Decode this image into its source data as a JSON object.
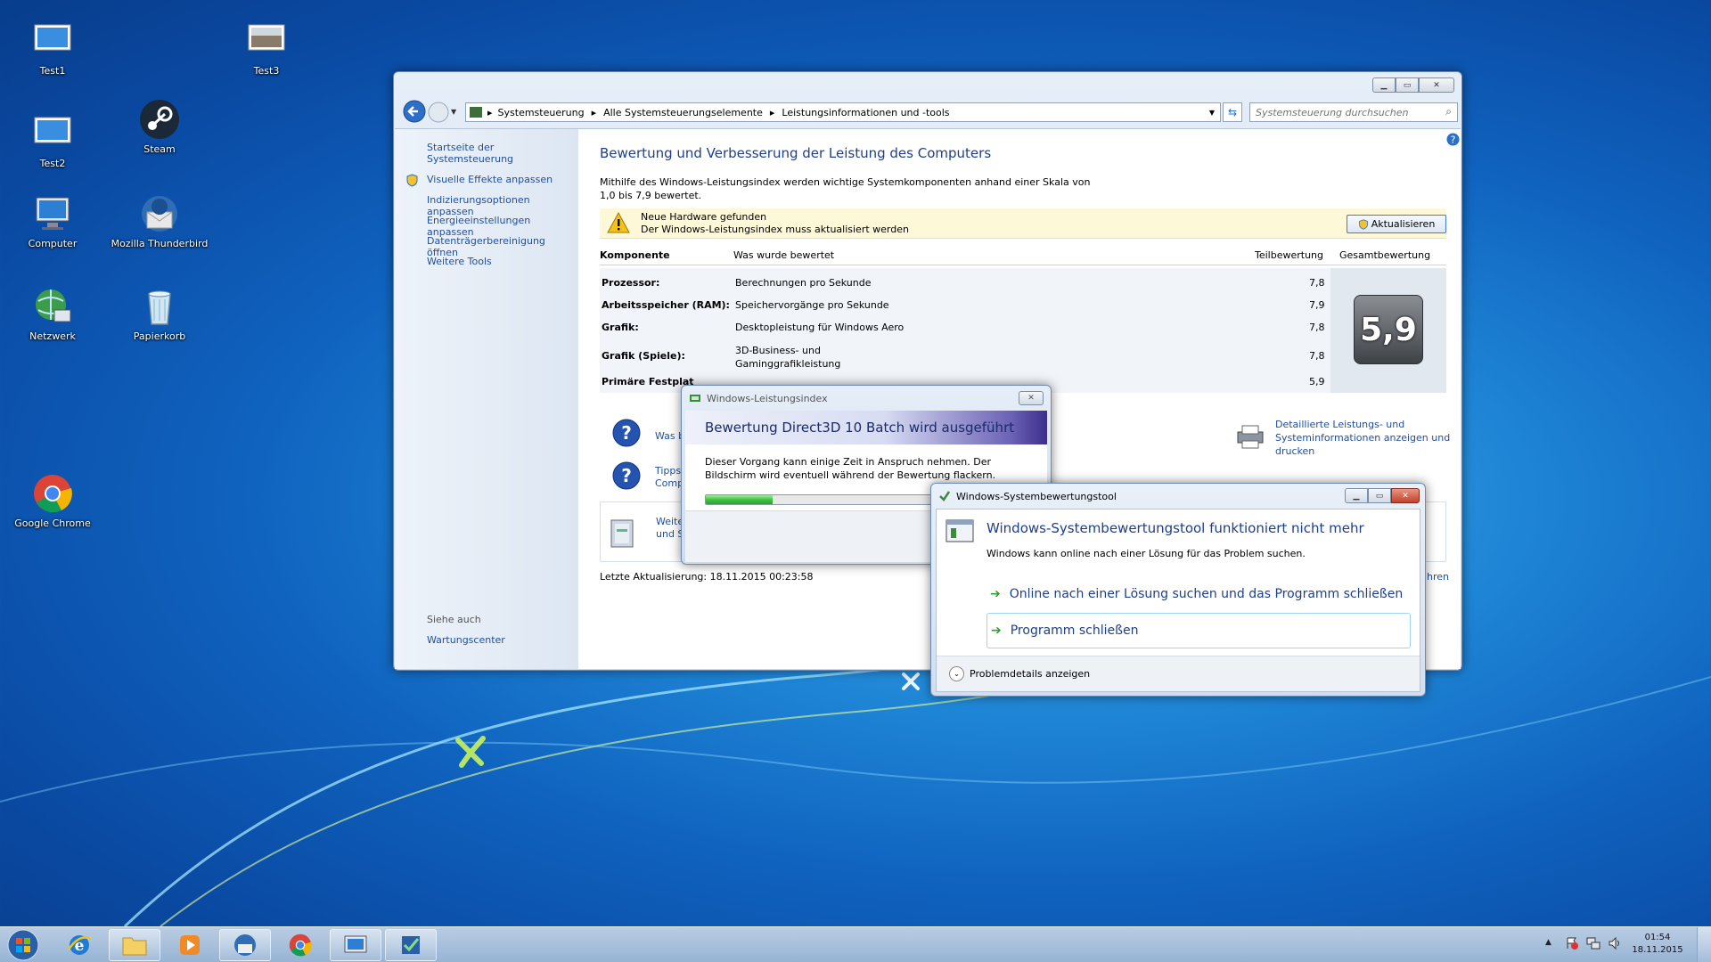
{
  "desktop": {
    "icons": [
      {
        "label": "Test1"
      },
      {
        "label": "Test3"
      },
      {
        "label": "Test2"
      },
      {
        "label": "Steam"
      },
      {
        "label": "Computer"
      },
      {
        "label": "Mozilla Thunderbird"
      },
      {
        "label": "Netzwerk"
      },
      {
        "label": "Papierkorb"
      },
      {
        "label": "Google Chrome"
      }
    ]
  },
  "cp": {
    "breadcrumb": [
      "Systemsteuerung",
      "Alle Systemsteuerungselemente",
      "Leistungsinformationen und -tools"
    ],
    "search_placeholder": "Systemsteuerung durchsuchen",
    "sidebar": {
      "home": "Startseite der Systemsteuerung",
      "links": [
        "Visuelle Effekte anpassen",
        "Indizierungsoptionen anpassen",
        "Energieeinstellungen anpassen",
        "Datenträgerbereinigung öffnen",
        "Weitere Tools"
      ],
      "see_also": "Siehe auch",
      "see_also_link": "Wartungscenter"
    },
    "title": "Bewertung und Verbesserung der Leistung des Computers",
    "intro": "Mithilfe des Windows-Leistungsindex werden wichtige Systemkomponenten anhand einer Skala von 1,0 bis 7,9 bewertet.",
    "notice_title": "Neue Hardware gefunden",
    "notice_text": "Der Windows-Leistungsindex muss aktualisiert werden",
    "update_button": "Aktualisieren",
    "table": {
      "headers": [
        "Komponente",
        "Was wurde bewertet",
        "Teilbewertung",
        "Gesamtbewertung"
      ],
      "rows": [
        {
          "component": "Prozessor:",
          "rated": "Berechnungen pro Sekunde",
          "score": "7,8"
        },
        {
          "component": "Arbeitsspeicher (RAM):",
          "rated": "Speichervorgänge pro Sekunde",
          "score": "7,9"
        },
        {
          "component": "Grafik:",
          "rated": "Desktopleistung für Windows Aero",
          "score": "7,8"
        },
        {
          "component": "Grafik (Spiele):",
          "rated": "3D-Business- und Gaminggrafikleistung",
          "score": "7,8"
        },
        {
          "component": "Primäre Festplat",
          "rated": "",
          "score": "5,9"
        }
      ],
      "overall": "5,9"
    },
    "help_links": [
      "Was b",
      "Tipps",
      "Comp",
      "Weite",
      "und S"
    ],
    "detail_link": "Detaillierte Leistungs- und Systeminformationen anzeigen und drucken",
    "trailing_link": "hren",
    "last_update": "Letzte Aktualisierung: 18.11.2015 00:23:58"
  },
  "wei_dialog": {
    "title": "Windows-Leistungsindex",
    "heading": "Bewertung Direct3D 10 Batch wird ausgeführt",
    "text": "Dieser Vorgang kann einige Zeit in Anspruch nehmen. Der Bildschirm wird eventuell während der Bewertung flackern.",
    "progress": 0.25
  },
  "crash_dialog": {
    "title": "Windows-Systembewertungstool",
    "heading": "Windows-Systembewertungstool funktioniert nicht mehr",
    "subtext": "Windows kann online nach einer Lösung für das Problem suchen.",
    "option1": "Online nach einer Lösung suchen und das Programm schließen",
    "option2": "Programm schließen",
    "details": "Problemdetails anzeigen"
  },
  "tray": {
    "time": "01:54",
    "date": "18.11.2015"
  },
  "colors": {
    "link": "#1f4e9b",
    "heading": "#1e3f86",
    "notice_bg": "#fdf8d8",
    "progress": "#3fc23f"
  }
}
